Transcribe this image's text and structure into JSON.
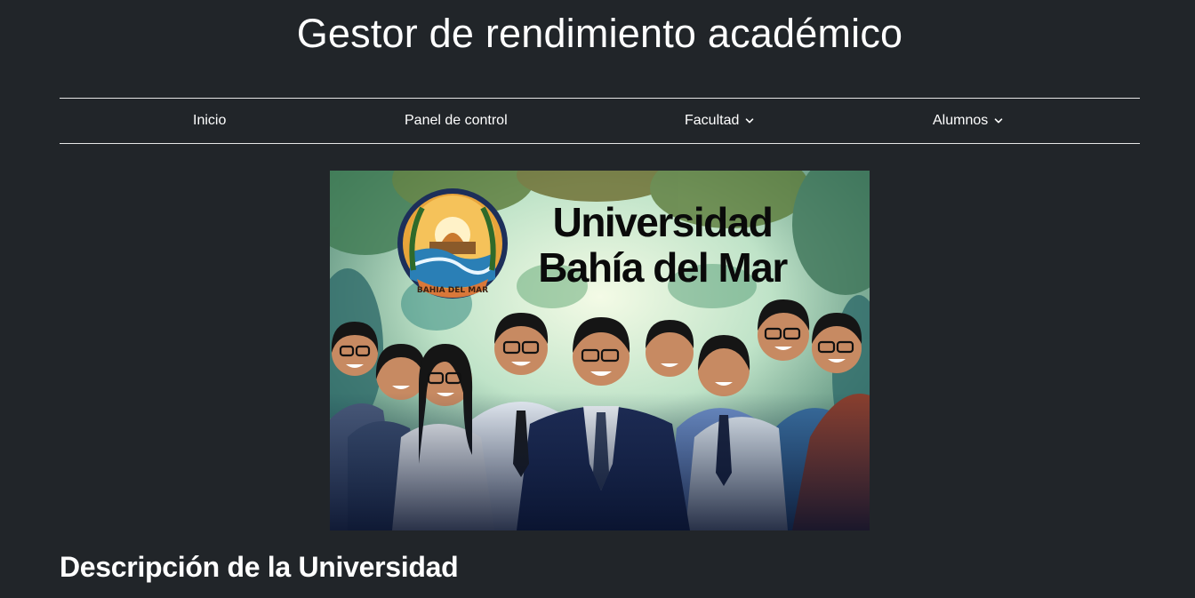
{
  "header": {
    "title": "Gestor de rendimiento académico"
  },
  "nav": {
    "items": [
      {
        "label": "Inicio",
        "has_dropdown": false
      },
      {
        "label": "Panel de control",
        "has_dropdown": false
      },
      {
        "label": "Facultad",
        "has_dropdown": true
      },
      {
        "label": "Alumnos",
        "has_dropdown": true
      }
    ]
  },
  "hero": {
    "title_line1": "Universidad",
    "title_line2": "Bahía del Mar",
    "seal_text": "BAHIA DEL MAR"
  },
  "main": {
    "section_title": "Descripción de la Universidad"
  },
  "colors": {
    "background": "#212529",
    "text": "#ffffff",
    "divider": "#e6e6e6"
  }
}
